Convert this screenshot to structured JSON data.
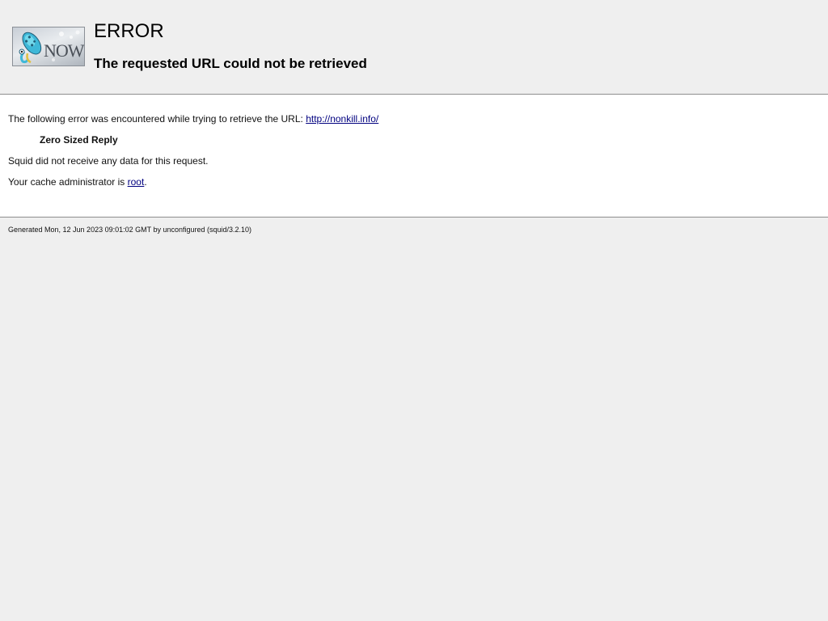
{
  "header": {
    "logo_text": "NOW",
    "title": "ERROR",
    "subtitle": "The requested URL could not be retrieved"
  },
  "content": {
    "intro_text": "The following error was encountered while trying to retrieve the URL: ",
    "url_link": "http://nonkill.info/",
    "error_name": "Zero Sized Reply",
    "description": "Squid did not receive any data for this request.",
    "admin_prefix": "Your cache administrator is ",
    "admin_link": "root",
    "admin_suffix": "."
  },
  "footer": {
    "generated_text": "Generated Mon, 12 Jun 2023 09:01:02 GMT by unconfigured (squid/3.2.10)"
  },
  "colors": {
    "page_background": "#efefef",
    "content_background": "#ffffff",
    "link": "#00007f",
    "divider": "#8e8e8e"
  },
  "icons": {
    "logo": "squid-logo-icon"
  }
}
